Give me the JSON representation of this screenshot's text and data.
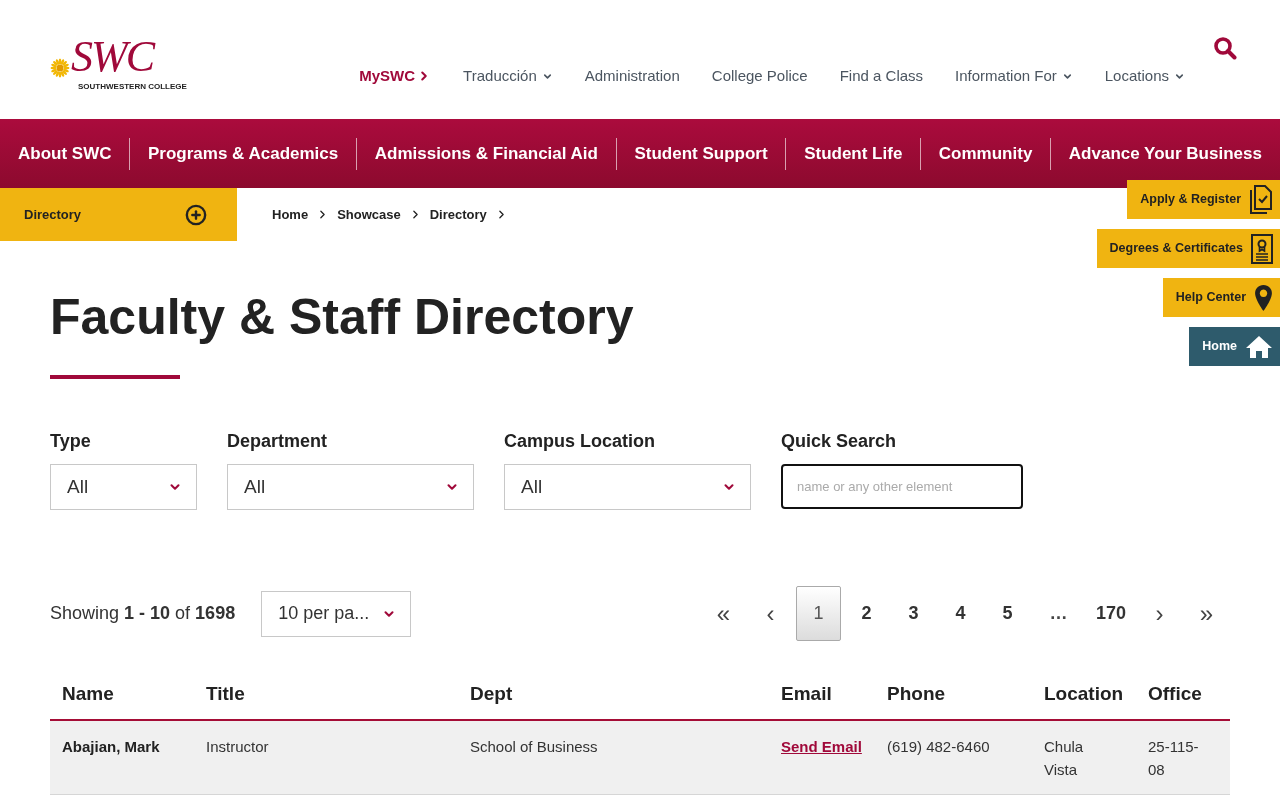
{
  "header": {
    "logo": {
      "wordmark": "SWC",
      "subtitle": "SOUTHWESTERN COLLEGE"
    },
    "utility_nav": [
      {
        "label": "MySWC",
        "kind": "featured"
      },
      {
        "label": "Traducción",
        "kind": "dropdown"
      },
      {
        "label": "Administration",
        "kind": "link"
      },
      {
        "label": "College Police",
        "kind": "link"
      },
      {
        "label": "Find a Class",
        "kind": "link"
      },
      {
        "label": "Information For",
        "kind": "dropdown"
      },
      {
        "label": "Locations",
        "kind": "dropdown"
      }
    ]
  },
  "main_nav": [
    "About SWC",
    "Programs & Academics",
    "Admissions & Financial Aid",
    "Student Support",
    "Student Life",
    "Community",
    "Advance Your Business"
  ],
  "section_menu": {
    "label": "Directory",
    "expanded": false
  },
  "breadcrumb": [
    "Home",
    "Showcase",
    "Directory"
  ],
  "quick_links": [
    {
      "label": "Apply & Register",
      "kind": "apply"
    },
    {
      "label": "Degrees & Certificates",
      "kind": "degrees"
    },
    {
      "label": "Help Center",
      "kind": "help"
    },
    {
      "label": "Home",
      "kind": "home"
    }
  ],
  "page_title": "Faculty & Staff Directory",
  "filters": [
    {
      "label": "Type",
      "kind": "select",
      "value": "All"
    },
    {
      "label": "Department",
      "kind": "select",
      "value": "All"
    },
    {
      "label": "Campus Location",
      "kind": "select",
      "value": "All"
    },
    {
      "label": "Quick Search",
      "kind": "search",
      "placeholder": "name or any other element"
    }
  ],
  "results": {
    "summary": "Showing **1 - 10** of **1698**",
    "page_size": "10 per pa..."
  },
  "pagination": [
    {
      "label": "«",
      "kind": "first",
      "selected": false
    },
    {
      "label": "‹",
      "kind": "previous",
      "selected": false
    },
    {
      "label": "1",
      "kind": "page",
      "selected": true
    },
    {
      "label": "2",
      "kind": "page",
      "selected": false
    },
    {
      "label": "3",
      "kind": "page",
      "selected": false
    },
    {
      "label": "4",
      "kind": "page",
      "selected": false
    },
    {
      "label": "5",
      "kind": "page",
      "selected": false
    },
    {
      "label": "…",
      "kind": "gap",
      "selected": false
    },
    {
      "label": "170",
      "kind": "page",
      "selected": false
    },
    {
      "label": "›",
      "kind": "next",
      "selected": false
    },
    {
      "label": "»",
      "kind": "last",
      "selected": false
    }
  ],
  "table": {
    "columns": [
      {
        "label": "Name",
        "kind": "name"
      },
      {
        "label": "Title",
        "kind": "text"
      },
      {
        "label": "Dept",
        "kind": "text"
      },
      {
        "label": "Email",
        "kind": "link"
      },
      {
        "label": "Phone",
        "kind": "text"
      },
      {
        "label": "Location",
        "kind": "text"
      },
      {
        "label": "Office",
        "kind": "text"
      }
    ],
    "rows": [
      [
        "Abajian, Mark",
        "Instructor",
        "School of Business",
        "Send Email",
        "(619) 482-6460",
        "Chula Vista",
        "25-115-08"
      ]
    ]
  }
}
